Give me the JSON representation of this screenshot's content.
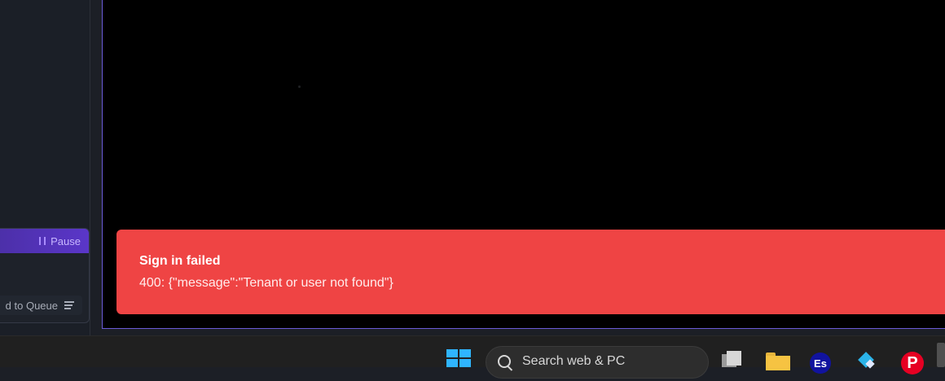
{
  "queue": {
    "pause_label": "Pause",
    "add_label": "d to Queue"
  },
  "toast": {
    "title": "Sign in failed",
    "message": "400: {\"message\":\"Tenant or user not found\"}"
  },
  "taskbar": {
    "search_placeholder": "Search web & PC",
    "es_label": "Es",
    "pinterest_label": "P"
  },
  "colors": {
    "toast_bg": "#ef4444",
    "accent_border": "#6a5bd7",
    "queue_header": "#4b2fa6"
  }
}
